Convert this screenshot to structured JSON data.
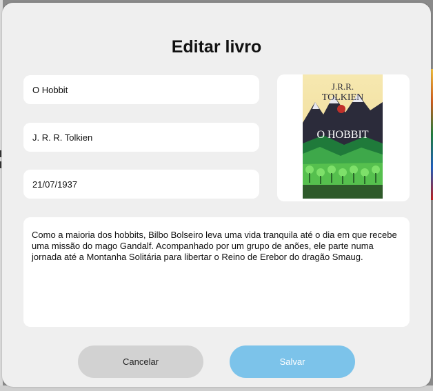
{
  "modal": {
    "title": "Editar livro"
  },
  "form": {
    "title_value": "O Hobbit",
    "author_value": "J. R. R. Tolkien",
    "date_value": "21/07/1937",
    "description_value": "Como a maioria dos hobbits, Bilbo Bolseiro leva uma vida tranquila até o dia em que recebe uma missão do mago Gandalf. Acompanhado por um grupo de anões, ele parte numa jornada até a Montanha Solitária para libertar o Reino de Erebor do dragão Smaug."
  },
  "cover": {
    "author_line1": "J.R.R.",
    "author_line2": "TOLKIEN",
    "book_title": "O HOBBIT"
  },
  "buttons": {
    "cancel_label": "Cancelar",
    "save_label": "Salvar"
  },
  "colors": {
    "modal_bg": "#efefef",
    "save_button": "#7cc3ea",
    "cancel_button": "#d2d2d2"
  }
}
